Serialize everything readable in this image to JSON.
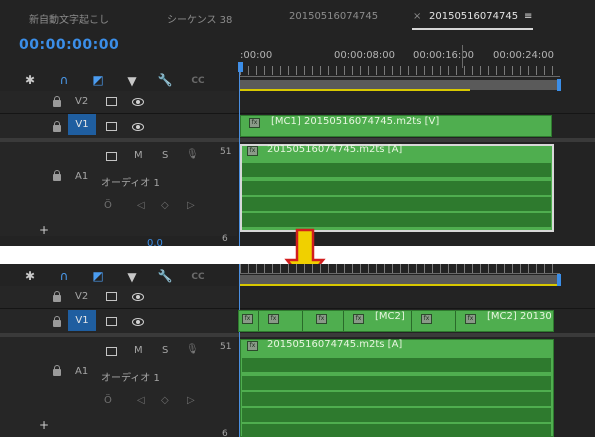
{
  "tabs": [
    {
      "label": "新自動文字起こし"
    },
    {
      "label": "シーケンス 38"
    },
    {
      "label": "20150516074745"
    },
    {
      "close": "×",
      "label": "20150516074745",
      "menu": "≡"
    }
  ],
  "timecode": "00:00:00:00",
  "ruler": {
    "labels": [
      ":00:00",
      "00:00:08:00",
      "00:00:16:00",
      "00:00:24:00"
    ]
  },
  "tools": {
    "snap": "✱",
    "magnet": "∩",
    "linked": "◩",
    "marker": "▼",
    "wrench": "🔧",
    "captions": "CC"
  },
  "tracks": {
    "v2": "V2",
    "v1": "V1",
    "v1_target": "V1",
    "a1": "A1",
    "audio_name": "オーディオ 1",
    "mute": "M",
    "solo": "S",
    "mic": "🎙",
    "level": "0.0",
    "num_51": "51",
    "num_6": "6",
    "add": "+",
    "keyframe_prev": "◁",
    "keyframe_add": "◇",
    "keyframe_next": "▷",
    "volume": "Ö"
  },
  "clips_top": {
    "video": "[MC1] 20150516074745.m2ts [V]",
    "audio": "20150516074745.m2ts [A]"
  },
  "clips_bottom": {
    "video_label_1": "[MC2]",
    "video_label_2": "[MC2] 20130",
    "audio": "20150516074745.m2ts [A]"
  },
  "bottom_markers": {
    "c1": "6"
  },
  "fx_glyph": "fx",
  "arrow": {
    "color": "#f0d000",
    "outline": "#d21e1e"
  },
  "colors": {
    "accent": "#3b8ee8",
    "clip_green": "#4fae4f",
    "target_blue": "#1f5ea0"
  }
}
